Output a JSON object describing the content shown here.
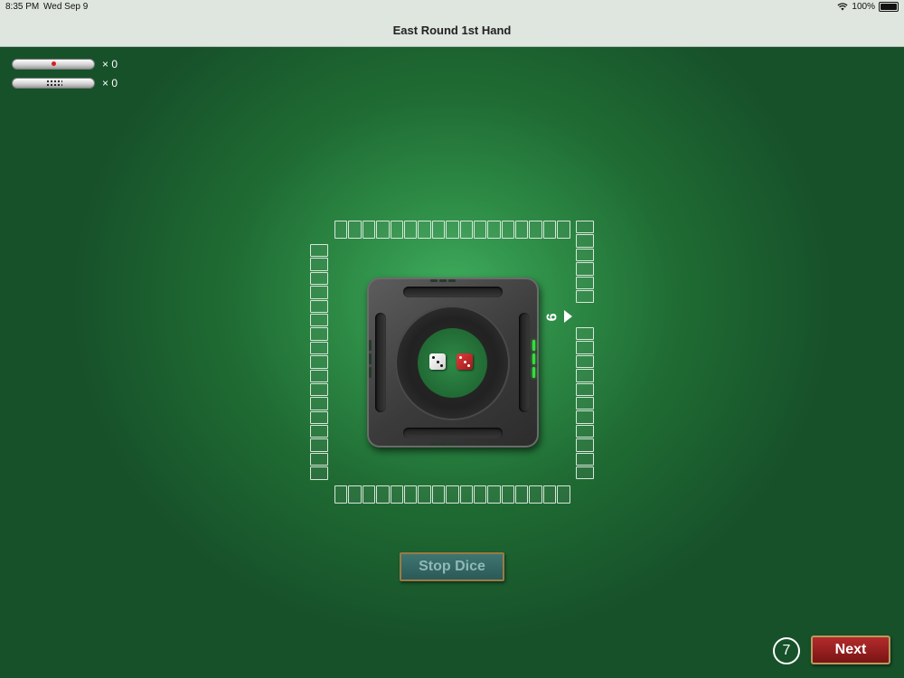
{
  "status_bar": {
    "time": "8:35 PM",
    "date": "Wed Sep 9",
    "battery": "100%",
    "wifi_icon": "wifi-icon",
    "battery_icon": "battery-icon"
  },
  "header": {
    "title": "East Round 1st Hand"
  },
  "scoreboard": {
    "riichi_sticks_count": "× 0",
    "honba_sticks_count": "× 0"
  },
  "wall": {
    "top_tiles": 17,
    "bottom_tiles": 17,
    "left_tiles": 17,
    "right_upper_tiles": 6,
    "right_lower_tiles": 11,
    "break_number": "9"
  },
  "dice": [
    {
      "color": "white",
      "face": 3
    },
    {
      "color": "red",
      "face": 3
    }
  ],
  "buttons": {
    "stop_dice": "Stop Dice",
    "next": "Next"
  },
  "timer": {
    "value": "7"
  },
  "colors": {
    "felt": "#2d8a45",
    "stop_dice_bg": "#2b5a58",
    "next_bg": "#9c1b1b",
    "active_indicator": "#31e03a"
  }
}
